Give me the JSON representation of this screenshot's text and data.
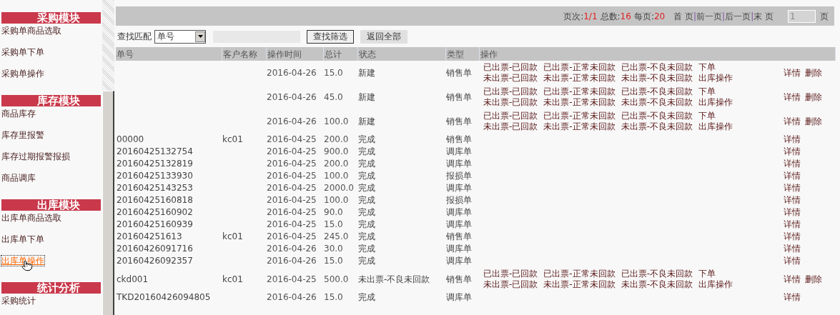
{
  "sidebar": {
    "sections": [
      {
        "title": "采购模块",
        "items": [
          {
            "label": "采购单商品选取",
            "hovered": false
          },
          {
            "label": "采购单下单",
            "hovered": false
          },
          {
            "label": "采购单操作",
            "hovered": false
          }
        ]
      },
      {
        "title": "库存模块",
        "items": [
          {
            "label": "商品库存",
            "hovered": false
          },
          {
            "label": "库存里报警",
            "hovered": false
          },
          {
            "label": "库存过期报警报损",
            "hovered": false
          },
          {
            "label": "商品调库",
            "hovered": false
          }
        ]
      },
      {
        "title": "出库模块",
        "items": [
          {
            "label": "出库单商品选取",
            "hovered": false
          },
          {
            "label": "出库单下单",
            "hovered": false
          },
          {
            "label": "出库单操作",
            "hovered": true
          }
        ]
      },
      {
        "title": "统计分析",
        "items": [
          {
            "label": "采购统计",
            "hovered": false
          }
        ]
      }
    ]
  },
  "pager": {
    "parts": [
      {
        "label": "页次:",
        "value": "1/1"
      },
      {
        "label": "总数:",
        "value": "16"
      },
      {
        "label": "每页:",
        "value": "20"
      }
    ],
    "links": [
      "首 页",
      "前一页",
      "后一页",
      "末 页"
    ],
    "separator": "|",
    "page_value": "1",
    "page_suffix": "页"
  },
  "search": {
    "label": "查找匹配",
    "select_value": "单号",
    "filter_button": "查找筛选",
    "reset_button": "返回全部"
  },
  "table": {
    "columns": [
      "单号",
      "客户名称",
      "操作时间",
      "总计",
      "状态",
      "类型",
      "操作"
    ],
    "rows": [
      {
        "number": "",
        "customer": "",
        "time": "2016-04-26",
        "total": "15.0",
        "status": "新建",
        "type": "销售单",
        "actions": [
          [
            "已出票-已回款",
            "已出票-正常未回款",
            "已出票-不良未回款",
            "下单"
          ],
          [
            "未出票-已回款",
            "未出票-正常未回款",
            "未出票-不良未回款",
            "出库操作"
          ]
        ],
        "detail": "详情",
        "delete": "删除"
      },
      {
        "number": "",
        "customer": "",
        "time": "2016-04-26",
        "total": "45.0",
        "status": "新建",
        "type": "销售单",
        "actions": [
          [
            "已出票-已回款",
            "已出票-正常未回款",
            "已出票-不良未回款",
            "下单"
          ],
          [
            "未出票-已回款",
            "未出票-正常未回款",
            "未出票-不良未回款",
            "出库操作"
          ]
        ],
        "detail": "详情",
        "delete": "删除"
      },
      {
        "number": "",
        "customer": "",
        "time": "2016-04-26",
        "total": "100.0",
        "status": "新建",
        "type": "销售单",
        "actions": [
          [
            "已出票-已回款",
            "已出票-正常未回款",
            "已出票-不良未回款",
            "下单"
          ],
          [
            "未出票-已回款",
            "未出票-正常未回款",
            "未出票-不良未回款",
            "出库操作"
          ]
        ],
        "detail": "详情",
        "delete": "删除"
      },
      {
        "number": "00000",
        "customer": "kc01",
        "time": "2016-04-25",
        "total": "200.0",
        "status": "完成",
        "type": "销售单",
        "detail": "详情"
      },
      {
        "number": "20160425132754",
        "customer": "",
        "time": "2016-04-25",
        "total": "900.0",
        "status": "完成",
        "type": "调库单",
        "detail": "详情"
      },
      {
        "number": "20160425132819",
        "customer": "",
        "time": "2016-04-25",
        "total": "200.0",
        "status": "完成",
        "type": "调库单",
        "detail": "详情"
      },
      {
        "number": "20160425133930",
        "customer": "",
        "time": "2016-04-25",
        "total": "100.0",
        "status": "完成",
        "type": "报损单",
        "detail": "详情"
      },
      {
        "number": "20160425143253",
        "customer": "",
        "time": "2016-04-25",
        "total": "2000.0",
        "status": "完成",
        "type": "调库单",
        "detail": "详情"
      },
      {
        "number": "20160425160818",
        "customer": "",
        "time": "2016-04-25",
        "total": "100.0",
        "status": "完成",
        "type": "报损单",
        "detail": "详情"
      },
      {
        "number": "20160425160902",
        "customer": "",
        "time": "2016-04-25",
        "total": "90.0",
        "status": "完成",
        "type": "调库单",
        "detail": "详情"
      },
      {
        "number": "20160425160939",
        "customer": "",
        "time": "2016-04-25",
        "total": "15.0",
        "status": "完成",
        "type": "调库单",
        "detail": "详情"
      },
      {
        "number": "201604251613",
        "customer": "kc01",
        "time": "2016-04-25",
        "total": "245.0",
        "status": "完成",
        "type": "销售单",
        "detail": "详情"
      },
      {
        "number": "20160426091716",
        "customer": "",
        "time": "2016-04-26",
        "total": "30.0",
        "status": "完成",
        "type": "调库单",
        "detail": "详情"
      },
      {
        "number": "20160426092357",
        "customer": "",
        "time": "2016-04-26",
        "total": "15.0",
        "status": "完成",
        "type": "调库单",
        "detail": "详情"
      },
      {
        "number": "ckd001",
        "customer": "kc01",
        "time": "2016-04-25",
        "total": "500.0",
        "status": "未出票-不良未回款",
        "type": "销售单",
        "actions": [
          [
            "已出票-已回款",
            "已出票-正常未回款",
            "已出票-不良未回款",
            "下单"
          ],
          [
            "未出票-已回款",
            "未出票-正常未回款",
            "未出票-不良未回款",
            "出库操作"
          ]
        ],
        "detail": "详情",
        "delete": "删除"
      },
      {
        "number": "TKD20160426094805",
        "customer": "",
        "time": "2016-04-26",
        "total": "15.0",
        "status": "完成",
        "type": "调库单",
        "detail": "详情"
      }
    ]
  }
}
